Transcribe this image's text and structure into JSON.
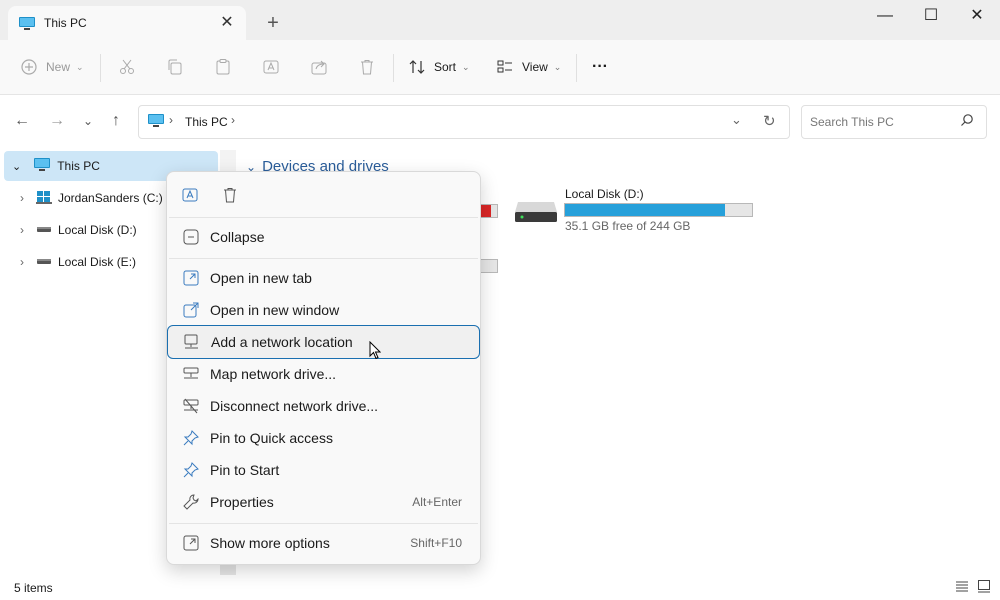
{
  "window": {
    "tab_title": "This PC",
    "new_tab": "+",
    "tab_close": "✕",
    "minimize": "—",
    "maximize": "☐",
    "close": "✕"
  },
  "toolbar": {
    "new_label": "New",
    "sort_label": "Sort",
    "view_label": "View",
    "more_label": "···"
  },
  "address": {
    "crumb": "This PC",
    "search_placeholder": "Search This PC"
  },
  "nav": {
    "items": [
      {
        "label": "This PC"
      },
      {
        "label": "JordanSanders (C:)"
      },
      {
        "label": "Local Disk (D:)"
      },
      {
        "label": "Local Disk (E:)"
      }
    ]
  },
  "content": {
    "section_title": "Devices and drives",
    "drive_d": {
      "name": "Local Disk (D:)",
      "free_text": "35.1 GB free of 244 GB",
      "used_fraction": 0.856
    },
    "bar_colors": {
      "normal": "#26a0da",
      "warning": "#da2626"
    }
  },
  "status": {
    "items_count": "5 items"
  },
  "context_menu": {
    "items": [
      {
        "label": "Collapse",
        "icon": "collapse-icon",
        "shortcut": ""
      },
      {
        "label": "Open in new tab",
        "icon": "open-tab-icon",
        "shortcut": ""
      },
      {
        "label": "Open in new window",
        "icon": "open-window-icon",
        "shortcut": ""
      },
      {
        "label": "Add a network location",
        "icon": "network-location-icon",
        "shortcut": ""
      },
      {
        "label": "Map network drive...",
        "icon": "map-drive-icon",
        "shortcut": ""
      },
      {
        "label": "Disconnect network drive...",
        "icon": "disconnect-drive-icon",
        "shortcut": ""
      },
      {
        "label": "Pin to Quick access",
        "icon": "pin-icon",
        "shortcut": ""
      },
      {
        "label": "Pin to Start",
        "icon": "pin-icon",
        "shortcut": ""
      },
      {
        "label": "Properties",
        "icon": "wrench-icon",
        "shortcut": "Alt+Enter"
      },
      {
        "label": "Show more options",
        "icon": "more-options-icon",
        "shortcut": "Shift+F10"
      }
    ]
  }
}
